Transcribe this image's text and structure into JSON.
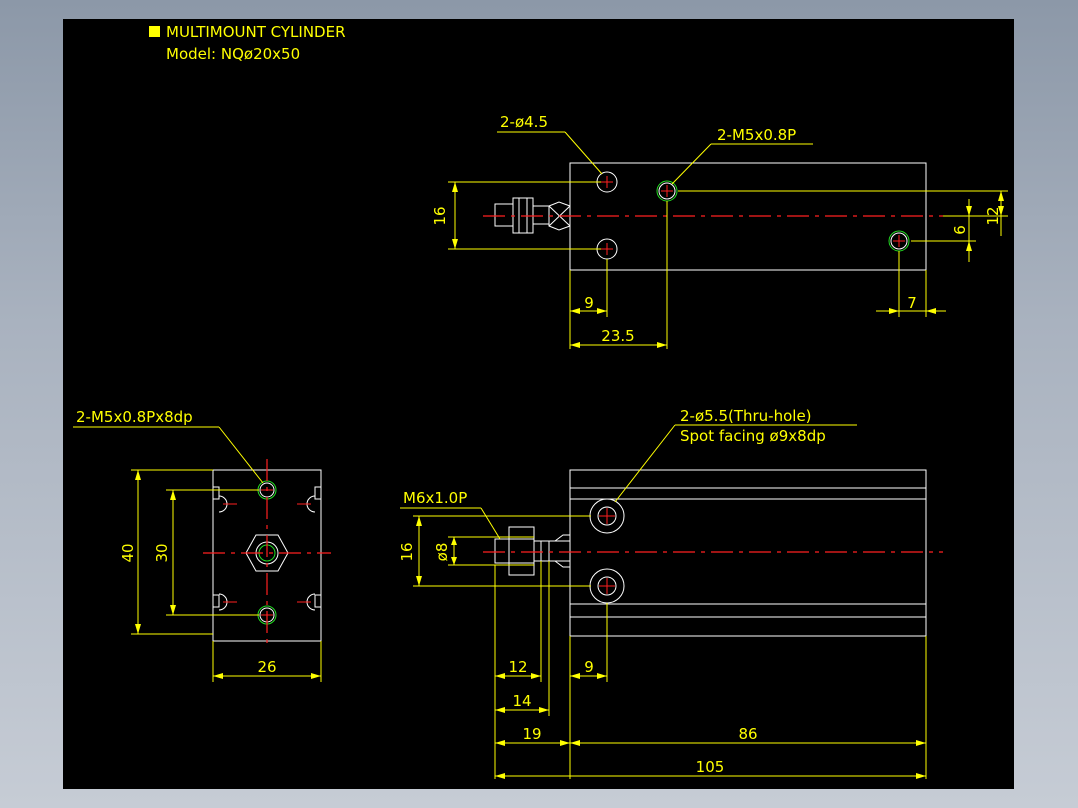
{
  "title": {
    "name": "MULTIMOUNT CYLINDER",
    "model": "Model: NQø20x50",
    "marker_color": "#ffff00"
  },
  "colors": {
    "background": "#000000",
    "outline": "#ffffff",
    "dimension": "#ffff00",
    "centerline": "#ff2020",
    "thread": "#22dd22"
  },
  "top_view": {
    "callout_holes": "2-ø4.5",
    "callout_thread": "2-M5x0.8P",
    "dim_height": "16",
    "dim_right_outer": "12",
    "dim_right_inner": "6",
    "dim_hole_x": "9",
    "dim_port_x": "23.5",
    "dim_rear_port": "7"
  },
  "end_view": {
    "callout_thread": "2-M5x0.8Px8dp",
    "dim_height_outer": "40",
    "dim_height_inner": "30",
    "dim_width": "26"
  },
  "side_view": {
    "callout_holes_line1": "2-ø5.5(Thru-hole)",
    "callout_holes_line2": "Spot facing ø9x8dp",
    "callout_rod_thread": "M6x1.0P",
    "dim_rod_dia": "ø8",
    "dim_height": "16",
    "dim_thread_len": "12",
    "dim_rod_len": "14",
    "dim_hole_x": "9",
    "dim_rod_ext": "19",
    "dim_body_len": "86",
    "dim_overall": "105"
  }
}
